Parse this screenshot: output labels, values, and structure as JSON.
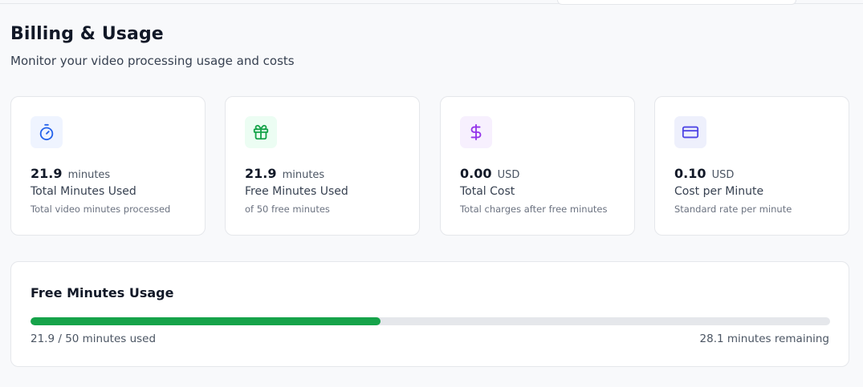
{
  "page": {
    "title": "Billing & Usage",
    "subtitle": "Monitor your video processing usage and costs"
  },
  "cards": [
    {
      "icon": "stopwatch-icon",
      "icon_color": "#2563eb",
      "icon_bg": "#eff4ff",
      "value": "21.9",
      "unit": "minutes",
      "label": "Total Minutes Used",
      "description": "Total video minutes processed"
    },
    {
      "icon": "gift-icon",
      "icon_color": "#16a34a",
      "icon_bg": "#ecfdf3",
      "value": "21.9",
      "unit": "minutes",
      "label": "Free Minutes Used",
      "description": "of 50 free minutes"
    },
    {
      "icon": "dollar-icon",
      "icon_color": "#9333ea",
      "icon_bg": "#f7f0fe",
      "value": "0.00",
      "unit": "USD",
      "label": "Total Cost",
      "description": "Total charges after free minutes"
    },
    {
      "icon": "credit-card-icon",
      "icon_color": "#4f46e5",
      "icon_bg": "#eef0fc",
      "value": "0.10",
      "unit": "USD",
      "label": "Cost per Minute",
      "description": "Standard rate per minute"
    }
  ],
  "usage": {
    "title": "Free Minutes Usage",
    "used": 21.9,
    "total": 50,
    "progress_fraction": 0.438,
    "used_text": "21.9 / 50 minutes used",
    "remaining_text": "28.1 minutes remaining",
    "bar_color": "#16a34a"
  }
}
